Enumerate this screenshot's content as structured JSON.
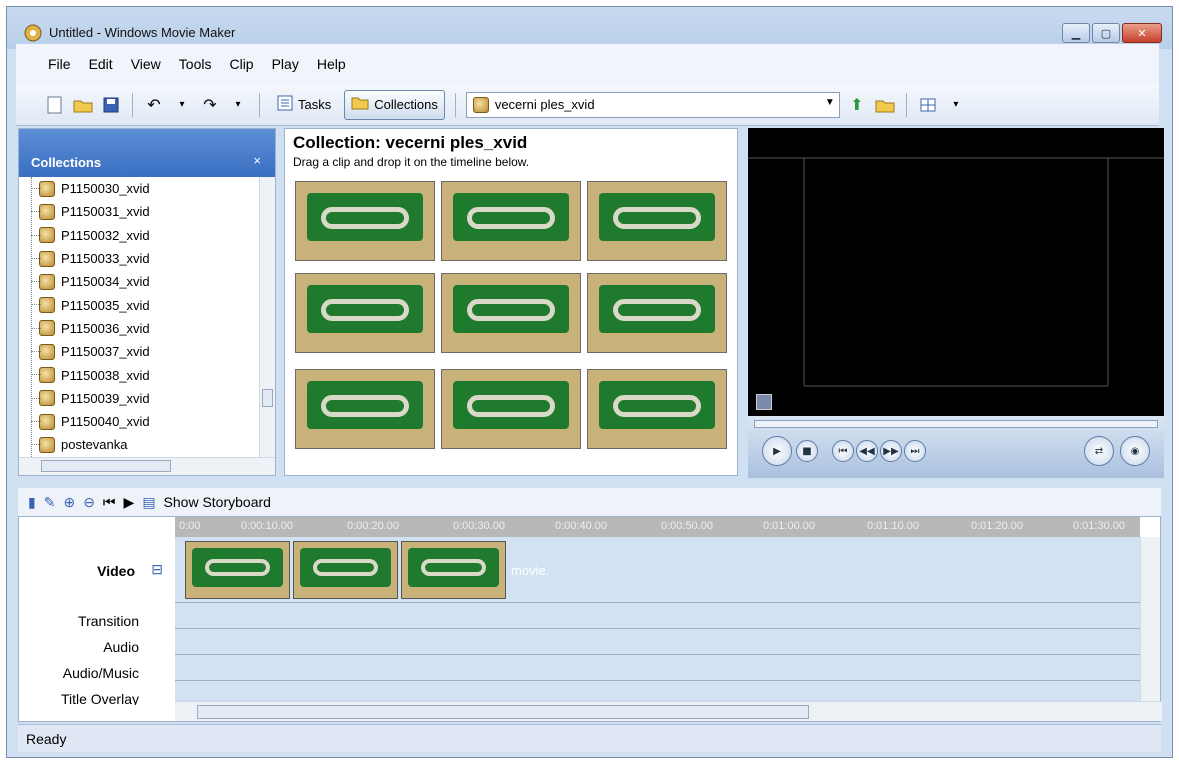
{
  "window": {
    "title": "Untitled - Windows Movie Maker"
  },
  "menu": [
    "File",
    "Edit",
    "View",
    "Tools",
    "Clip",
    "Play",
    "Help"
  ],
  "toolbar": {
    "tasks_label": "Tasks",
    "collections_label": "Collections",
    "collection_select": "vecerni ples_xvid"
  },
  "collections_pane": {
    "header": "Collections",
    "close_glyph": "×",
    "items": [
      "P1150030_xvid",
      "P1150031_xvid",
      "P1150032_xvid",
      "P1150033_xvid",
      "P1150034_xvid",
      "P1150035_xvid",
      "P1150036_xvid",
      "P1150037_xvid",
      "P1150038_xvid",
      "P1150039_xvid",
      "P1150040_xvid",
      "postevanka"
    ]
  },
  "collection_view": {
    "title": "Collection: vecerni ples_xvid",
    "subtitle": "Drag a clip and drop it on the timeline below."
  },
  "timeline_toolbar": {
    "show_storyboard_label": "Show Storyboard"
  },
  "timeline": {
    "ruler_ticks": [
      "0:00",
      "0:00:10.00",
      "0:00:20.00",
      "0:00:30.00",
      "0:00:40.00",
      "0:00:50.00",
      "0:01:00.00",
      "0:01:10.00",
      "0:01:20.00",
      "0:01:30.00"
    ],
    "tracks": {
      "video": "Video",
      "transition": "Transition",
      "audio": "Audio",
      "audio_music": "Audio/Music",
      "title_overlay": "Title Overlay"
    },
    "drop_hint": "movie."
  },
  "status": {
    "text": "Ready"
  },
  "colors": {
    "chrome": "#cfe0f3",
    "accent": "#3a6fc2",
    "field": "#1f7a2e",
    "table": "#c9b27a"
  }
}
